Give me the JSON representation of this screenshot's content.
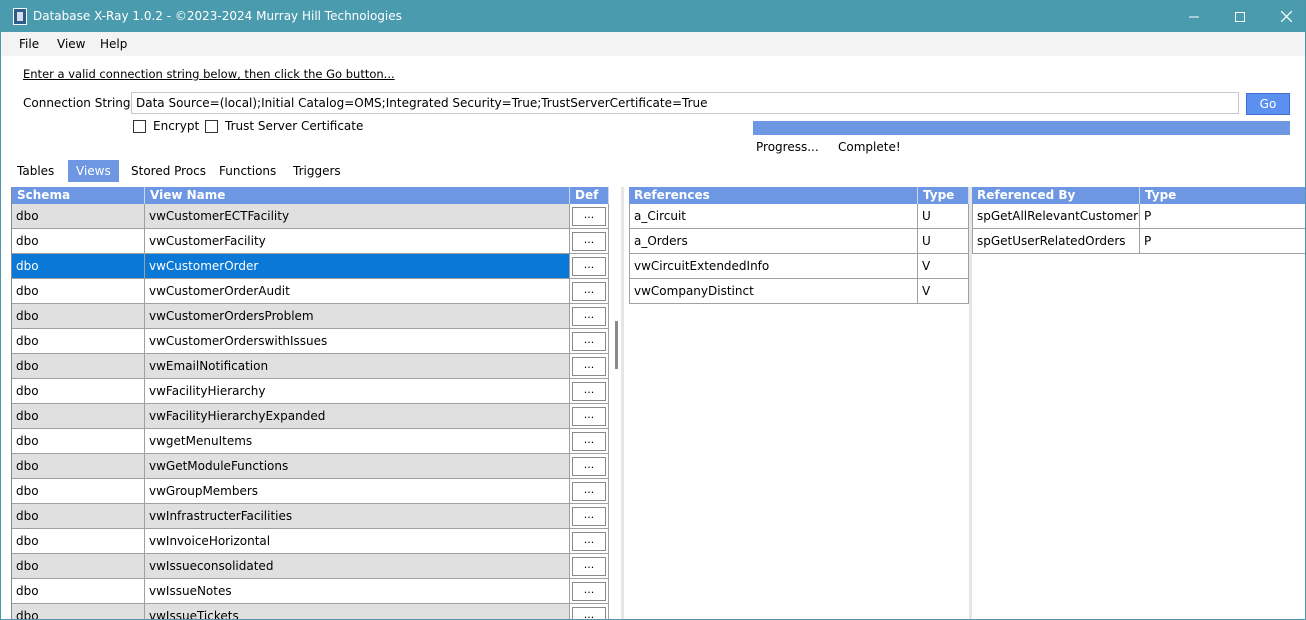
{
  "window": {
    "title": "Database X-Ray 1.0.2 - ©2023-2024 Murray Hill Technologies",
    "controls": {
      "minimize": "—",
      "maximize": "☐",
      "close": "✕"
    }
  },
  "menu": {
    "file": "File",
    "view": "View",
    "help": "Help"
  },
  "connection": {
    "instruction": "Enter a valid connection string below, then click the Go button...",
    "label": "Connection String:",
    "value": "Data Source=(local);Initial Catalog=OMS;Integrated Security=True;TrustServerCertificate=True",
    "go_label": "Go",
    "encrypt_label": "Encrypt",
    "encrypt_checked": false,
    "trust_label": "Trust Server Certificate",
    "trust_checked": false
  },
  "progress": {
    "label": "Progress...",
    "status": "Complete!",
    "fraction": 1.0
  },
  "tabs": [
    {
      "label": "Tables",
      "active": false
    },
    {
      "label": "Views",
      "active": true
    },
    {
      "label": "Stored Procs",
      "active": false
    },
    {
      "label": "Functions",
      "active": false
    },
    {
      "label": "Triggers",
      "active": false
    }
  ],
  "views_grid": {
    "headers": {
      "schema": "Schema",
      "name": "View Name",
      "def": "Def"
    },
    "def_button_label": "...",
    "rows": [
      {
        "schema": "dbo",
        "name": "vwCustomerECTFacility"
      },
      {
        "schema": "dbo",
        "name": "vwCustomerFacility"
      },
      {
        "schema": "dbo",
        "name": "vwCustomerOrder",
        "selected": true
      },
      {
        "schema": "dbo",
        "name": "vwCustomerOrderAudit"
      },
      {
        "schema": "dbo",
        "name": "vwCustomerOrdersProblem"
      },
      {
        "schema": "dbo",
        "name": "vwCustomerOrderswithIssues"
      },
      {
        "schema": "dbo",
        "name": "vwEmailNotification"
      },
      {
        "schema": "dbo",
        "name": "vwFacilityHierarchy"
      },
      {
        "schema": "dbo",
        "name": "vwFacilityHierarchyExpanded"
      },
      {
        "schema": "dbo",
        "name": "vwgetMenuItems"
      },
      {
        "schema": "dbo",
        "name": "vwGetModuleFunctions"
      },
      {
        "schema": "dbo",
        "name": "vwGroupMembers"
      },
      {
        "schema": "dbo",
        "name": "vwInfrastructerFacilities"
      },
      {
        "schema": "dbo",
        "name": "vwInvoiceHorizontal"
      },
      {
        "schema": "dbo",
        "name": "vwIssueconsolidated"
      },
      {
        "schema": "dbo",
        "name": "vwIssueNotes"
      },
      {
        "schema": "dbo",
        "name": "vwIssueTickets"
      }
    ]
  },
  "references_grid": {
    "headers": {
      "name": "References",
      "type": "Type"
    },
    "rows": [
      {
        "name": "a_Circuit",
        "type": "U"
      },
      {
        "name": "a_Orders",
        "type": "U"
      },
      {
        "name": "vwCircuitExtendedInfo",
        "type": "V"
      },
      {
        "name": "vwCompanyDistinct",
        "type": "V"
      }
    ]
  },
  "referenced_by_grid": {
    "headers": {
      "name": "Referenced By",
      "type": "Type"
    },
    "rows": [
      {
        "name": "spGetAllRelevantCustomerO...",
        "type": "P"
      },
      {
        "name": "spGetUserRelatedOrders",
        "type": "P"
      }
    ]
  },
  "colors": {
    "titlebar": "#4a9bad",
    "accent": "#6d97e3",
    "selection": "#0a78d7",
    "alt_row": "#e0e0e0"
  }
}
